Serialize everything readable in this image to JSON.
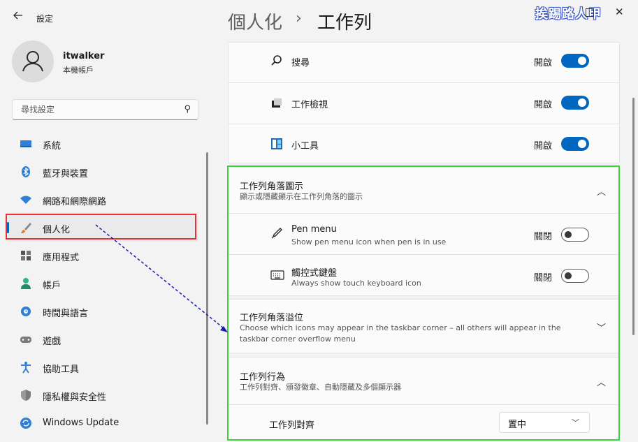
{
  "app": {
    "title": "設定",
    "watermark": "挨踢路人甲"
  },
  "profile": {
    "name": "itwalker",
    "account_type": "本機帳戶"
  },
  "search": {
    "placeholder": "尋找設定"
  },
  "nav": [
    {
      "label": "系統",
      "icon": "monitor-icon"
    },
    {
      "label": "藍牙與裝置",
      "icon": "bluetooth-icon"
    },
    {
      "label": "網路和網際網路",
      "icon": "wifi-icon"
    },
    {
      "label": "個人化",
      "icon": "brush-icon",
      "selected": true
    },
    {
      "label": "應用程式",
      "icon": "apps-icon"
    },
    {
      "label": "帳戶",
      "icon": "person-icon"
    },
    {
      "label": "時間與語言",
      "icon": "clock-globe-icon"
    },
    {
      "label": "遊戲",
      "icon": "gamepad-icon"
    },
    {
      "label": "協助工具",
      "icon": "accessibility-icon"
    },
    {
      "label": "隱私權與安全性",
      "icon": "shield-icon"
    },
    {
      "label": "Windows Update",
      "icon": "update-icon"
    }
  ],
  "breadcrumb": {
    "parent": "個人化",
    "separator": "›",
    "current": "工作列"
  },
  "taskbar_items": [
    {
      "label": "搜尋",
      "state": "開啟",
      "on": true,
      "icon": "search-icon"
    },
    {
      "label": "工作檢視",
      "state": "開啟",
      "on": true,
      "icon": "task-view-icon"
    },
    {
      "label": "小工具",
      "state": "開啟",
      "on": true,
      "icon": "widgets-icon"
    }
  ],
  "corner_icons": {
    "title": "工作列角落圖示",
    "subtitle": "顯示或隱藏顯示在工作列角落的圖示",
    "items": [
      {
        "label": "Pen menu",
        "desc": "Show pen menu icon when pen is in use",
        "state": "關閉",
        "on": false,
        "icon": "pen-icon"
      },
      {
        "label": "觸控式鍵盤",
        "desc": "Always show touch keyboard icon",
        "state": "關閉",
        "on": false,
        "icon": "keyboard-icon"
      }
    ]
  },
  "corner_overflow": {
    "title": "工作列角落溢位",
    "subtitle": "Choose which icons may appear in the taskbar corner – all others will appear in the taskbar corner overflow menu"
  },
  "behaviors": {
    "title": "工作列行為",
    "subtitle": "工作列對齊、頒發徽章、自動隱藏及多個顯示器",
    "alignment_label": "工作列對齊",
    "alignment_value": "置中"
  },
  "colors": {
    "accent": "#0067c0",
    "highlight_red": "#e63232",
    "highlight_green": "#37d63a",
    "arrow": "#1c1cb0"
  }
}
